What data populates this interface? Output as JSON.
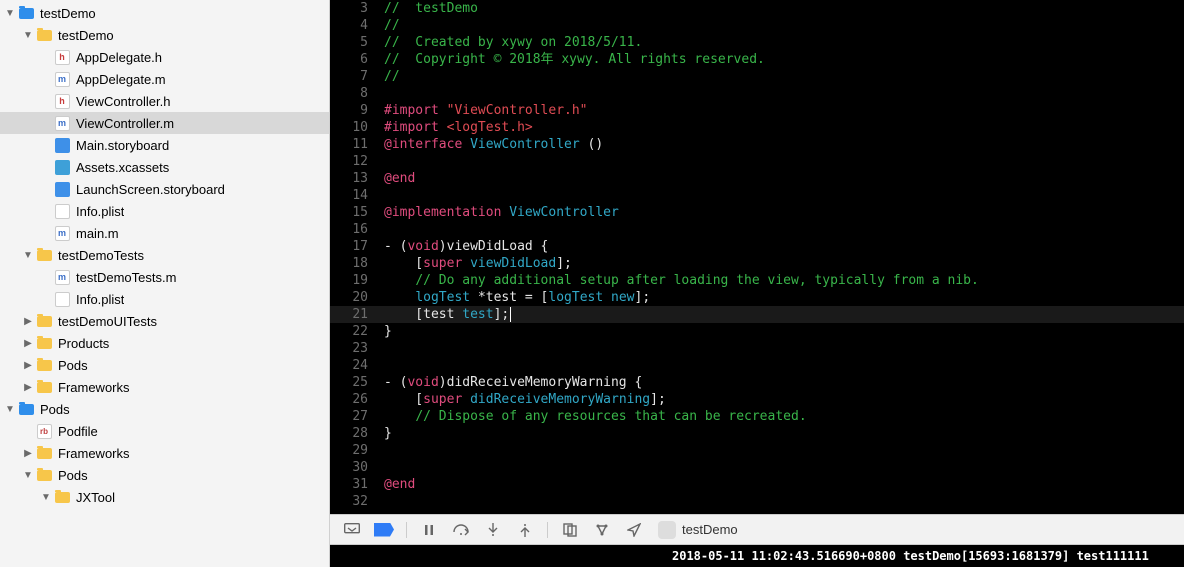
{
  "navigator": {
    "items": [
      {
        "depth": 0,
        "disclosure": "open",
        "icon": "folder-blue",
        "label": "testDemo"
      },
      {
        "depth": 1,
        "disclosure": "open",
        "icon": "folder-yellow",
        "label": "testDemo"
      },
      {
        "depth": 2,
        "disclosure": "none",
        "icon": "file-h",
        "glyph": "h",
        "label": "AppDelegate.h"
      },
      {
        "depth": 2,
        "disclosure": "none",
        "icon": "file-m",
        "glyph": "m",
        "label": "AppDelegate.m"
      },
      {
        "depth": 2,
        "disclosure": "none",
        "icon": "file-h",
        "glyph": "h",
        "label": "ViewController.h"
      },
      {
        "depth": 2,
        "disclosure": "none",
        "icon": "file-m",
        "glyph": "m",
        "label": "ViewController.m",
        "selected": true
      },
      {
        "depth": 2,
        "disclosure": "none",
        "icon": "file-storyboard",
        "label": "Main.storyboard"
      },
      {
        "depth": 2,
        "disclosure": "none",
        "icon": "file-assets",
        "label": "Assets.xcassets"
      },
      {
        "depth": 2,
        "disclosure": "none",
        "icon": "file-storyboard",
        "label": "LaunchScreen.storyboard"
      },
      {
        "depth": 2,
        "disclosure": "none",
        "icon": "file-plist",
        "label": "Info.plist"
      },
      {
        "depth": 2,
        "disclosure": "none",
        "icon": "file-m",
        "glyph": "m",
        "label": "main.m"
      },
      {
        "depth": 1,
        "disclosure": "open",
        "icon": "folder-yellow",
        "label": "testDemoTests"
      },
      {
        "depth": 2,
        "disclosure": "none",
        "icon": "file-m",
        "glyph": "m",
        "label": "testDemoTests.m"
      },
      {
        "depth": 2,
        "disclosure": "none",
        "icon": "file-plist",
        "label": "Info.plist"
      },
      {
        "depth": 1,
        "disclosure": "closed",
        "icon": "folder-yellow",
        "label": "testDemoUITests"
      },
      {
        "depth": 1,
        "disclosure": "closed",
        "icon": "folder-yellow",
        "label": "Products"
      },
      {
        "depth": 1,
        "disclosure": "closed",
        "icon": "folder-yellow",
        "label": "Pods"
      },
      {
        "depth": 1,
        "disclosure": "closed",
        "icon": "folder-yellow",
        "label": "Frameworks"
      },
      {
        "depth": 0,
        "disclosure": "open",
        "icon": "folder-blue",
        "label": "Pods"
      },
      {
        "depth": 1,
        "disclosure": "none",
        "icon": "file-rb",
        "glyph": "rb",
        "label": "Podfile"
      },
      {
        "depth": 1,
        "disclosure": "closed",
        "icon": "folder-yellow",
        "label": "Frameworks"
      },
      {
        "depth": 1,
        "disclosure": "open",
        "icon": "folder-yellow",
        "label": "Pods"
      },
      {
        "depth": 2,
        "disclosure": "open",
        "icon": "folder-yellow",
        "label": "JXTool"
      }
    ]
  },
  "editor": {
    "lines": [
      {
        "n": 3,
        "spans": [
          {
            "cls": "c-comment",
            "t": "//  testDemo"
          }
        ]
      },
      {
        "n": 4,
        "spans": [
          {
            "cls": "c-comment",
            "t": "//"
          }
        ]
      },
      {
        "n": 5,
        "spans": [
          {
            "cls": "c-comment",
            "t": "//  Created by xywy on 2018/5/11."
          }
        ]
      },
      {
        "n": 6,
        "spans": [
          {
            "cls": "c-comment",
            "t": "//  Copyright © 2018年 xywy. All rights reserved."
          }
        ]
      },
      {
        "n": 7,
        "spans": [
          {
            "cls": "c-comment",
            "t": "//"
          }
        ]
      },
      {
        "n": 8,
        "spans": [
          {
            "cls": "c-plain",
            "t": ""
          }
        ]
      },
      {
        "n": 9,
        "spans": [
          {
            "cls": "c-pre",
            "t": "#import "
          },
          {
            "cls": "c-str",
            "t": "\"ViewController.h\""
          }
        ]
      },
      {
        "n": 10,
        "spans": [
          {
            "cls": "c-pre",
            "t": "#import "
          },
          {
            "cls": "c-str",
            "t": "<logTest.h>"
          }
        ]
      },
      {
        "n": 11,
        "spans": [
          {
            "cls": "c-obj",
            "t": "@interface"
          },
          {
            "cls": "c-plain",
            "t": " "
          },
          {
            "cls": "c-type",
            "t": "ViewController"
          },
          {
            "cls": "c-plain",
            "t": " ()"
          }
        ]
      },
      {
        "n": 12,
        "spans": [
          {
            "cls": "c-plain",
            "t": ""
          }
        ]
      },
      {
        "n": 13,
        "spans": [
          {
            "cls": "c-obj",
            "t": "@end"
          }
        ]
      },
      {
        "n": 14,
        "spans": [
          {
            "cls": "c-plain",
            "t": ""
          }
        ]
      },
      {
        "n": 15,
        "spans": [
          {
            "cls": "c-obj",
            "t": "@implementation"
          },
          {
            "cls": "c-plain",
            "t": " "
          },
          {
            "cls": "c-type",
            "t": "ViewController"
          }
        ]
      },
      {
        "n": 16,
        "spans": [
          {
            "cls": "c-plain",
            "t": ""
          }
        ]
      },
      {
        "n": 17,
        "spans": [
          {
            "cls": "c-plain",
            "t": "- ("
          },
          {
            "cls": "c-key",
            "t": "void"
          },
          {
            "cls": "c-plain",
            "t": ")viewDidLoad {"
          }
        ]
      },
      {
        "n": 18,
        "spans": [
          {
            "cls": "c-plain",
            "t": "    ["
          },
          {
            "cls": "c-key",
            "t": "super"
          },
          {
            "cls": "c-plain",
            "t": " "
          },
          {
            "cls": "c-func",
            "t": "viewDidLoad"
          },
          {
            "cls": "c-plain",
            "t": "];"
          }
        ]
      },
      {
        "n": 19,
        "spans": [
          {
            "cls": "c-plain",
            "t": "    "
          },
          {
            "cls": "c-comment",
            "t": "// Do any additional setup after loading the view, typically from a nib."
          }
        ]
      },
      {
        "n": 20,
        "spans": [
          {
            "cls": "c-plain",
            "t": "    "
          },
          {
            "cls": "c-type",
            "t": "logTest"
          },
          {
            "cls": "c-plain",
            "t": " *test = ["
          },
          {
            "cls": "c-type",
            "t": "logTest"
          },
          {
            "cls": "c-plain",
            "t": " "
          },
          {
            "cls": "c-func",
            "t": "new"
          },
          {
            "cls": "c-plain",
            "t": "];"
          }
        ]
      },
      {
        "n": 21,
        "hl": true,
        "spans": [
          {
            "cls": "c-plain",
            "t": "    [test "
          },
          {
            "cls": "c-func",
            "t": "test"
          },
          {
            "cls": "c-plain",
            "t": "];"
          },
          {
            "cls": "c-cursor",
            "t": ""
          }
        ]
      },
      {
        "n": 22,
        "spans": [
          {
            "cls": "c-plain",
            "t": "}"
          }
        ]
      },
      {
        "n": 23,
        "spans": [
          {
            "cls": "c-plain",
            "t": ""
          }
        ]
      },
      {
        "n": 24,
        "spans": [
          {
            "cls": "c-plain",
            "t": ""
          }
        ]
      },
      {
        "n": 25,
        "spans": [
          {
            "cls": "c-plain",
            "t": "- ("
          },
          {
            "cls": "c-key",
            "t": "void"
          },
          {
            "cls": "c-plain",
            "t": ")didReceiveMemoryWarning {"
          }
        ]
      },
      {
        "n": 26,
        "spans": [
          {
            "cls": "c-plain",
            "t": "    ["
          },
          {
            "cls": "c-key",
            "t": "super"
          },
          {
            "cls": "c-plain",
            "t": " "
          },
          {
            "cls": "c-func",
            "t": "didReceiveMemoryWarning"
          },
          {
            "cls": "c-plain",
            "t": "];"
          }
        ]
      },
      {
        "n": 27,
        "spans": [
          {
            "cls": "c-plain",
            "t": "    "
          },
          {
            "cls": "c-comment",
            "t": "// Dispose of any resources that can be recreated."
          }
        ]
      },
      {
        "n": 28,
        "spans": [
          {
            "cls": "c-plain",
            "t": "}"
          }
        ]
      },
      {
        "n": 29,
        "spans": [
          {
            "cls": "c-plain",
            "t": ""
          }
        ]
      },
      {
        "n": 30,
        "spans": [
          {
            "cls": "c-plain",
            "t": ""
          }
        ]
      },
      {
        "n": 31,
        "spans": [
          {
            "cls": "c-obj",
            "t": "@end"
          }
        ]
      },
      {
        "n": 32,
        "spans": [
          {
            "cls": "c-plain",
            "t": ""
          }
        ]
      }
    ]
  },
  "debugbar": {
    "app_name": "testDemo"
  },
  "console": {
    "line": "2018-05-11 11:02:43.516690+0800 testDemo[15693:1681379] test111111"
  }
}
